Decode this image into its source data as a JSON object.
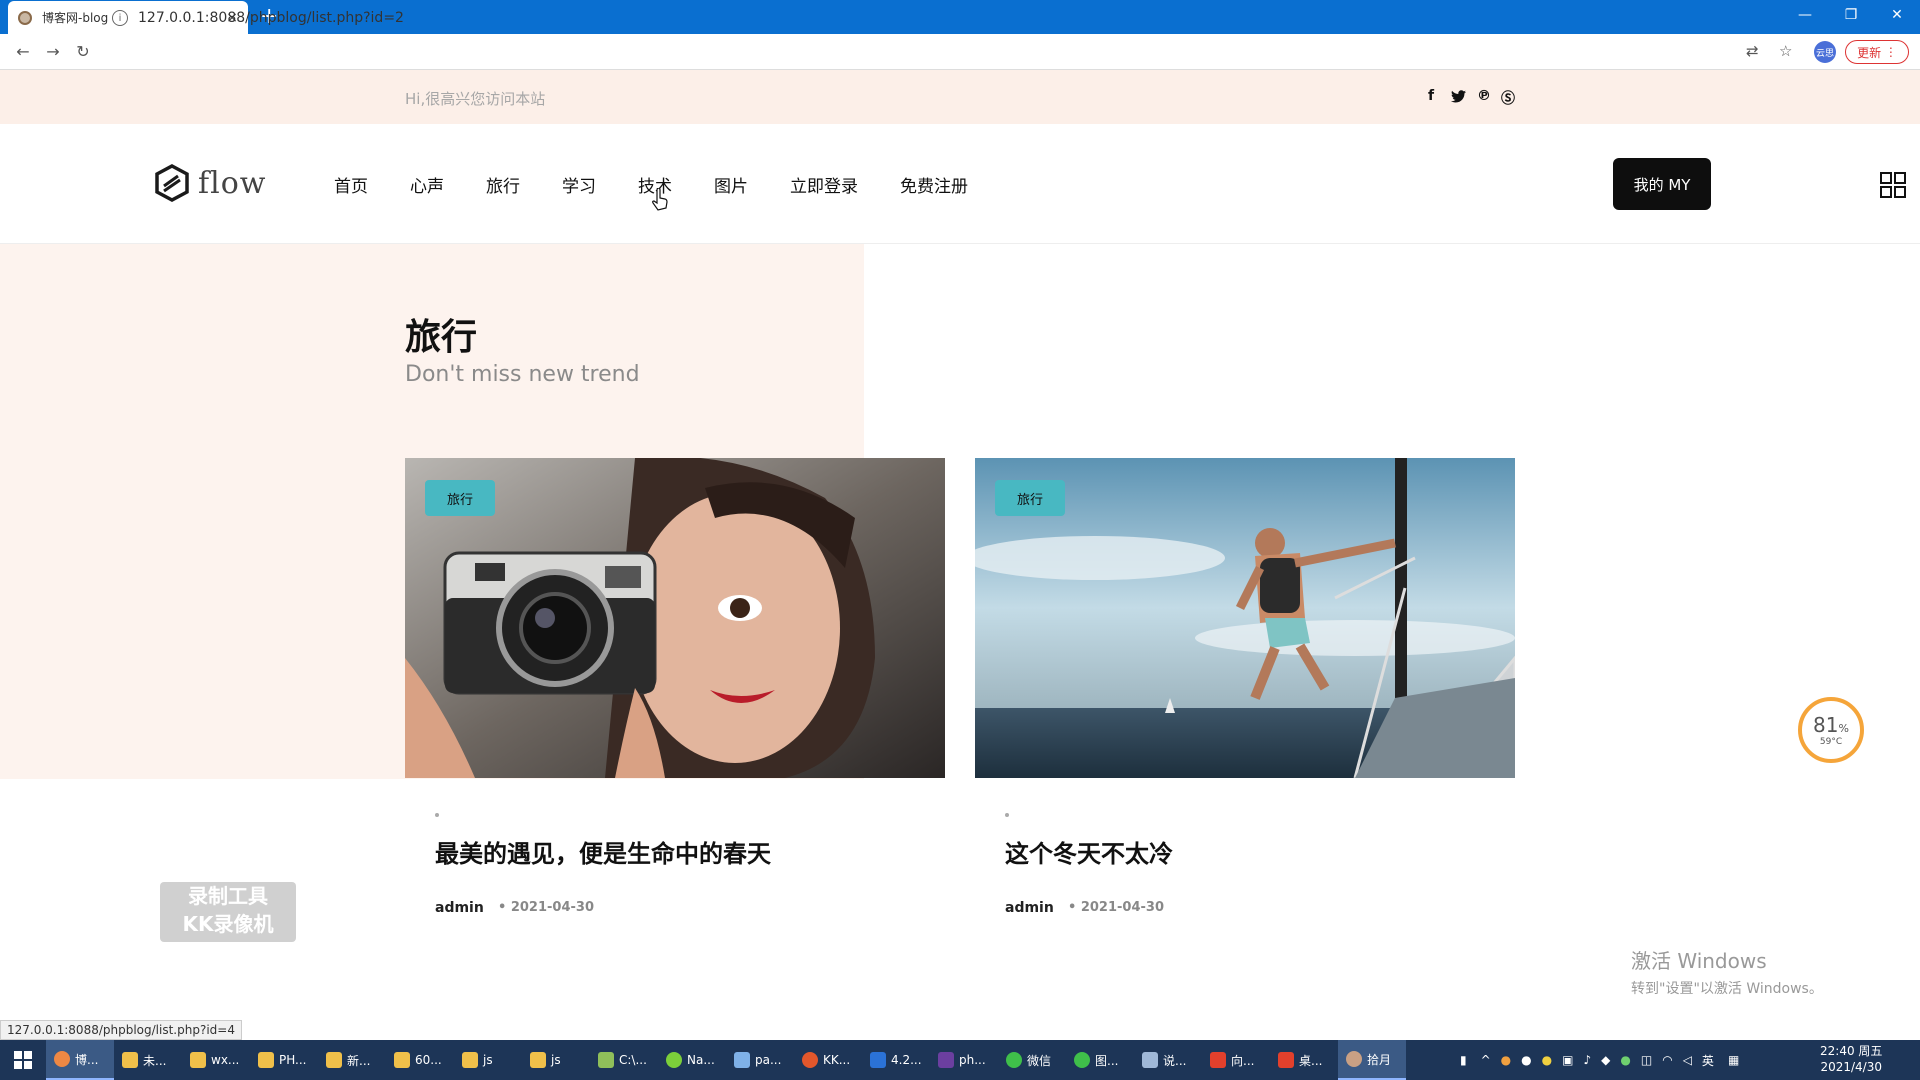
{
  "browser": {
    "tab_title": "博客网-blog",
    "tab_close": "×",
    "new_tab": "+",
    "url": "127.0.0.1:8088/phpblog/list.php?id=2",
    "update_label": "更新",
    "profile_label": "云思",
    "status_url": "127.0.0.1:8088/phpblog/list.php?id=4"
  },
  "topbar": {
    "greeting": "Hi,很高兴您访问本站",
    "social_icons": [
      "facebook-icon",
      "twitter-icon",
      "pinterest-icon",
      "skype-icon"
    ]
  },
  "header": {
    "logo_text": "flow",
    "nav": [
      "首页",
      "心声",
      "旅行",
      "学习",
      "技术",
      "图片",
      "立即登录",
      "免费注册"
    ],
    "my_button": "我的 MY"
  },
  "page": {
    "title": "旅行",
    "subtitle": "Don't miss new trend"
  },
  "posts": [
    {
      "category": "旅行",
      "title": "最美的遇见，便是生命中的春天",
      "author": "admin",
      "date": "2021-04-30"
    },
    {
      "category": "旅行",
      "title": "这个冬天不太冷",
      "author": "admin",
      "date": "2021-04-30"
    }
  ],
  "widgets": {
    "cpu_percent": "81",
    "cpu_unit": "%",
    "cpu_temp": "59°C",
    "watermark_line1": "录制工具",
    "watermark_line2": "KK录像机",
    "activate_title": "激活 Windows",
    "activate_sub": "转到\"设置\"以激活 Windows。"
  },
  "taskbar": {
    "items": [
      "博...",
      "未...",
      "wx...",
      "PH...",
      "新...",
      "60...",
      "js",
      "js",
      "C:\\...",
      "Na...",
      "pa...",
      "KK...",
      "4.2...",
      "ph...",
      "微信",
      "图...",
      "说...",
      "向...",
      "桌...",
      "拾月"
    ],
    "ime": "英",
    "time": "22:40 周五",
    "date": "2021/4/30"
  },
  "colors": {
    "accent_badge": "#48b8c2",
    "top_strip": "#fcefe8",
    "browser_blue": "#0a6fd0"
  }
}
